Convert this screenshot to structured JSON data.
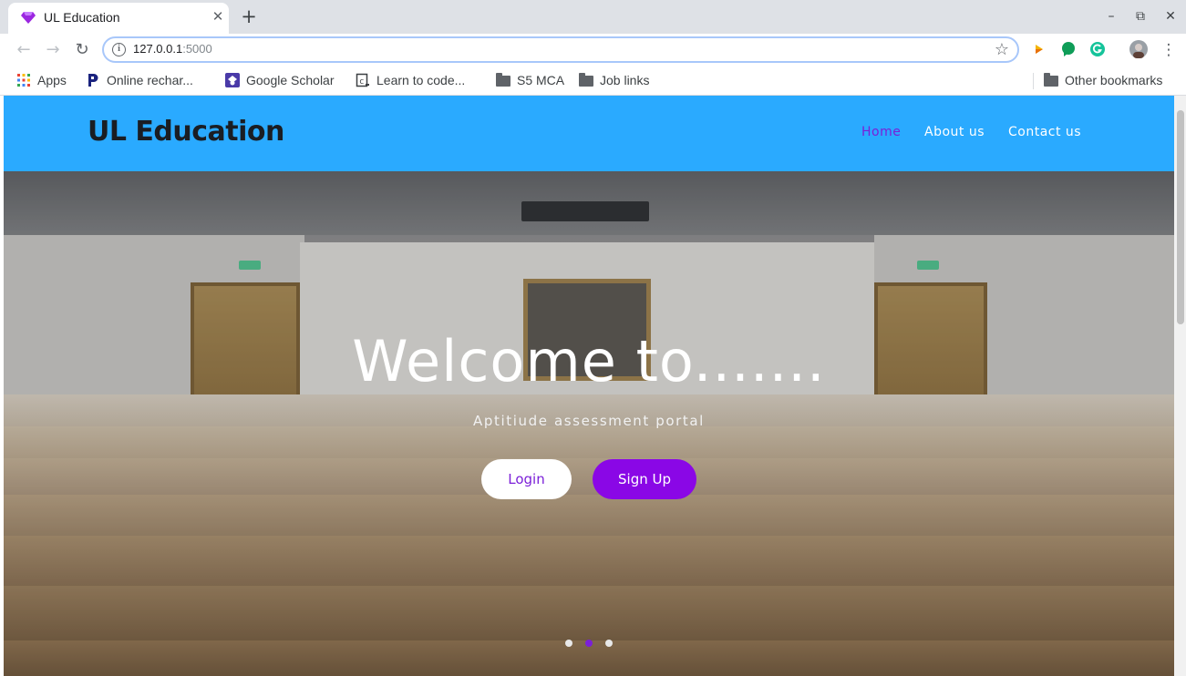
{
  "browser": {
    "tab": {
      "title": "UL Education",
      "favicon": "diamond-icon",
      "close_glyph": "✕"
    },
    "new_tab_glyph": "+",
    "window_controls": {
      "minimize": "–",
      "maximize": "⧉",
      "close": "✕"
    },
    "nav": {
      "back": "←",
      "forward": "→",
      "reload": "↻"
    },
    "address": {
      "host": "127.0.0.1",
      "port": ":5000",
      "info_glyph": "i",
      "star_glyph": "☆"
    },
    "menu_glyph": "⋮",
    "bookmarks": [
      {
        "label": "Apps",
        "icon": "apps-grid-icon"
      },
      {
        "label": "Online rechar...",
        "icon": "paytm-icon"
      },
      {
        "label": "Google Scholar",
        "icon": "scholar-icon"
      },
      {
        "label": "Learn to code...",
        "icon": "code-icon"
      },
      {
        "label": "S5 MCA",
        "icon": "folder-icon"
      },
      {
        "label": "Job links",
        "icon": "folder-icon"
      }
    ],
    "other_bookmarks": "Other bookmarks"
  },
  "site": {
    "brand": "UL Education",
    "nav": [
      {
        "label": "Home",
        "active": true
      },
      {
        "label": "About us",
        "active": false
      },
      {
        "label": "Contact us",
        "active": false
      }
    ],
    "hero": {
      "title": "Welcome to.......",
      "subtitle": "Aptitiude assessment portal",
      "login_label": "Login",
      "signup_label": "Sign Up",
      "carousel": {
        "count": 3,
        "active_index": 1
      }
    }
  },
  "colors": {
    "nav_bg": "#2aaaff",
    "brand_text": "#1a1d23",
    "active_link": "#7b1fd8",
    "signup_bg": "#8a07e6"
  }
}
